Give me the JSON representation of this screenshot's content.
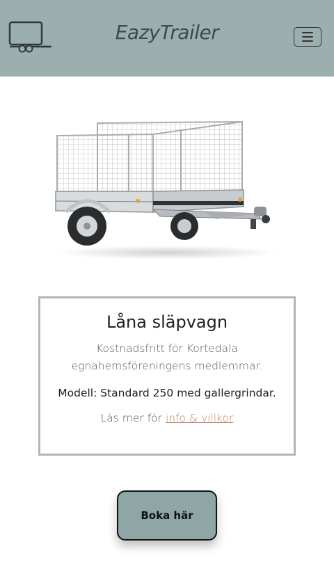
{
  "header": {
    "brand": "EazyTrailer",
    "logo_icon": "trailer-logo-icon",
    "menu_icon": "hamburger-menu-icon",
    "background": "#9aafae"
  },
  "hero": {
    "image": "trailer-with-mesh-cage-image"
  },
  "card": {
    "title": "Låna släpvagn",
    "description": "Kostnadsfritt för Kortedala egnahemsföreningens medlemmar.",
    "model": "Modell: Standard 250 med gallergrindar.",
    "more_prefix": "Läs mer för ",
    "more_link": "info & villkor"
  },
  "booking": {
    "button_label": "Boka här",
    "button_color": "#8fa6a6"
  }
}
